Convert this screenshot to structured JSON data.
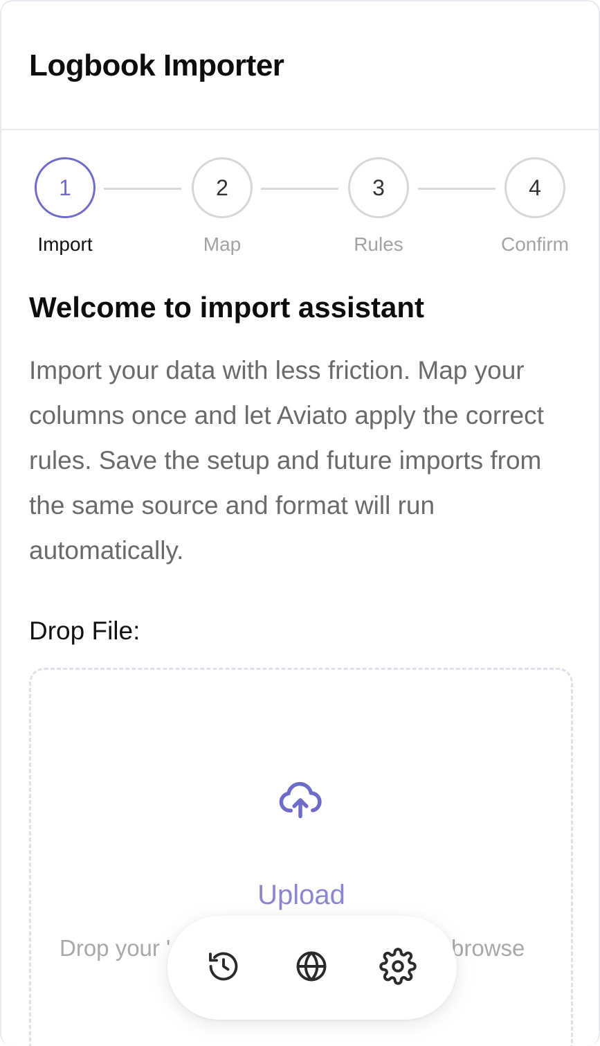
{
  "app": {
    "title": "Logbook Importer"
  },
  "stepper": {
    "steps": [
      {
        "number": "1",
        "label": "Import",
        "active": true
      },
      {
        "number": "2",
        "label": "Map",
        "active": false
      },
      {
        "number": "3",
        "label": "Rules",
        "active": false
      },
      {
        "number": "4",
        "label": "Confirm",
        "active": false
      }
    ]
  },
  "main": {
    "heading": "Welcome to import assistant",
    "description": "Import your data with less friction. Map your columns once and let Aviato apply the correct rules. Save the setup and future imports from the same source and format will run automatically.",
    "drop_label": "Drop File:",
    "upload": {
      "icon": "cloud-upload-icon",
      "label": "Upload",
      "hint_left": "Drop your '",
      "hint_right": "browse"
    }
  },
  "toolbar": {
    "items": [
      {
        "icon": "history-icon",
        "name": "history"
      },
      {
        "icon": "globe-icon",
        "name": "language"
      },
      {
        "icon": "gear-icon",
        "name": "settings"
      }
    ]
  },
  "colors": {
    "accent": "#6f6cc8",
    "upload_text": "#8b86cf",
    "muted": "#a3a3a3",
    "border": "#e6e9ef"
  }
}
